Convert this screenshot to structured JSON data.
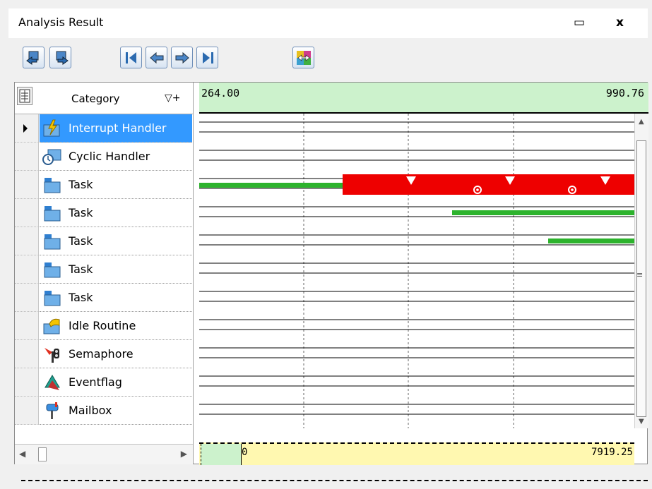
{
  "window": {
    "title": "Analysis Result",
    "minimize_glyph": "▭",
    "close_glyph": "x"
  },
  "toolbar": {
    "buttons": [
      {
        "icon": "history-back-icon"
      },
      {
        "icon": "history-forward-icon"
      },
      {
        "icon": "first-icon"
      },
      {
        "icon": "previous-icon"
      },
      {
        "icon": "next-icon"
      },
      {
        "icon": "last-icon"
      },
      {
        "icon": "sync-icon"
      }
    ]
  },
  "list": {
    "header": "Category",
    "filter_glyph": "▽+",
    "rows": [
      {
        "label": "Interrupt Handler",
        "icon": "interrupt-handler-icon",
        "selected": true
      },
      {
        "label": "Cyclic Handler",
        "icon": "cyclic-handler-icon"
      },
      {
        "label": "Task",
        "icon": "task-icon"
      },
      {
        "label": "Task",
        "icon": "task-icon"
      },
      {
        "label": "Task",
        "icon": "task-icon"
      },
      {
        "label": "Task",
        "icon": "task-icon"
      },
      {
        "label": "Task",
        "icon": "task-icon"
      },
      {
        "label": "Idle Routine",
        "icon": "idle-routine-icon"
      },
      {
        "label": "Semaphore",
        "icon": "semaphore-icon"
      },
      {
        "label": "Eventflag",
        "icon": "eventflag-icon"
      },
      {
        "label": "Mailbox",
        "icon": "mailbox-icon"
      }
    ]
  },
  "timeline": {
    "range_start": "264.00",
    "range_end": "990.76",
    "overview_start": "0",
    "overview_end": "7919.25",
    "colors": {
      "running": "#ee0000",
      "ready": "#2db32d",
      "overview": "#fff8b0",
      "window": "#ccf2cc"
    }
  }
}
